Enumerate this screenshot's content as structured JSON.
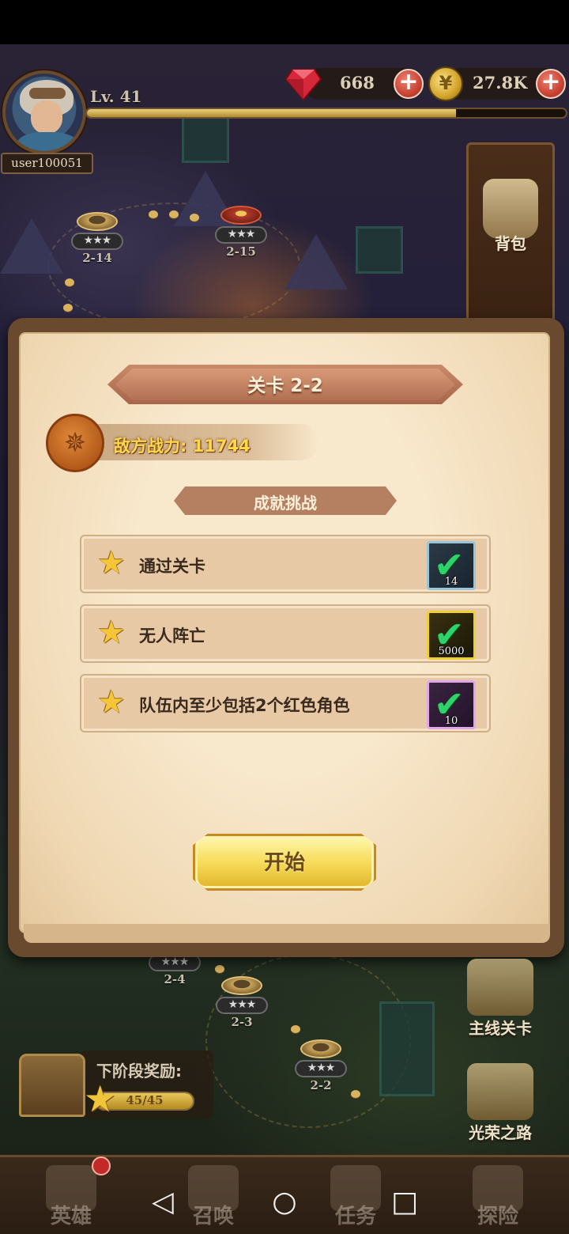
{
  "player": {
    "level": "Lv. 41",
    "username": "user100051",
    "xp_fraction": 0.77
  },
  "currencies": {
    "gems": "668",
    "gold": "27.8K"
  },
  "side_menu": {
    "bag_label": "背包"
  },
  "map_nodes": [
    {
      "label": "2-14",
      "stars": "★★★"
    },
    {
      "label": "2-15",
      "stars": "★★★"
    },
    {
      "label": "2-4",
      "stars": "★★★"
    },
    {
      "label": "2-3",
      "stars": "★★★"
    },
    {
      "label": "2-2",
      "stars": "★★★"
    }
  ],
  "dialog": {
    "title": "关卡 2-2",
    "enemy_power": "敌方战力: 11744",
    "section_title": "成就挑战",
    "challenges": [
      {
        "text": "通过关卡",
        "reward_qty": "14",
        "completed": true
      },
      {
        "text": "无人阵亡",
        "reward_qty": "5000",
        "completed": true
      },
      {
        "text": "队伍内至少包括2个红色角色",
        "reward_qty": "10",
        "completed": true
      }
    ],
    "start_label": "开始"
  },
  "stage_reward": {
    "title": "下阶段奖励:",
    "progress": "45/45",
    "progress_fraction": 1.0
  },
  "map_buttons": {
    "main_stage": "主线关卡",
    "glory_road": "光荣之路"
  },
  "bottom_nav": {
    "heroes": "英雄",
    "summon": "召唤",
    "quests": "任务",
    "explore": "探险"
  },
  "system_nav": {
    "back": "◁",
    "home": "○",
    "recent": "□"
  },
  "colors": {
    "accent_gold": "#f7dc5a",
    "check_green": "#2dd36a",
    "power_yellow": "#ffd84a"
  }
}
